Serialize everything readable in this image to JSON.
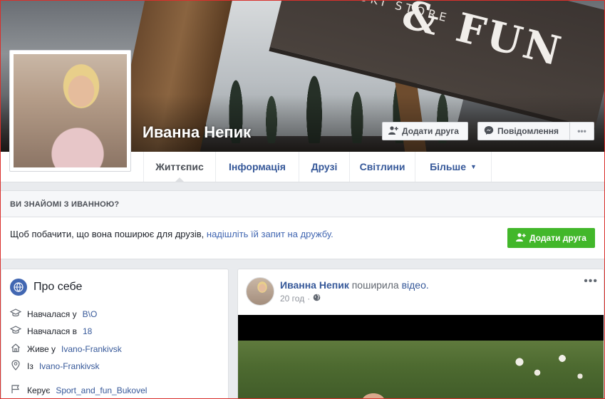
{
  "profile": {
    "name": "Иванна Непик",
    "add_friend_label": "Додати друга",
    "message_label": "Повідомлення",
    "more_label": "•••"
  },
  "cover": {
    "sign_text_big": "& FUN",
    "sign_text_small": "RAND SKI STORE"
  },
  "tabs": [
    {
      "label": "Життєпис",
      "active": true
    },
    {
      "label": "Інформація"
    },
    {
      "label": "Друзі"
    },
    {
      "label": "Світлини"
    },
    {
      "label": "Більше"
    }
  ],
  "know_panel": {
    "heading": "ВИ ЗНАЙОМІ З ИВАННОЮ?",
    "message_prefix": "Щоб побачити, що вона поширює для друзів,",
    "message_link": "надішліть їй запит на дружбу.",
    "button_label": "Додати друга"
  },
  "about": {
    "title": "Про себе",
    "rows": [
      {
        "icon": "graduation-cap-icon",
        "prefix": "Навчалася у",
        "link": "В\\О"
      },
      {
        "icon": "graduation-cap-icon",
        "prefix": "Навчалася в",
        "link": "18"
      },
      {
        "icon": "home-icon",
        "prefix": "Живе у",
        "link": "Ivano-Frankivsk"
      },
      {
        "icon": "map-pin-icon",
        "prefix": "Із",
        "link": "Ivano-Frankivsk"
      },
      {
        "icon": "flag-icon",
        "prefix": "Керує",
        "link": "Sport_and_fun_Bukovel"
      }
    ]
  },
  "post": {
    "author": "Иванна Непик",
    "action": "поширила",
    "object": "відео.",
    "time": "20 год",
    "separator": "·",
    "more_label": "•••"
  },
  "colors": {
    "link": "#365899",
    "brand": "#4267b2",
    "green": "#42b72a",
    "page_bg": "#e9ebee"
  }
}
